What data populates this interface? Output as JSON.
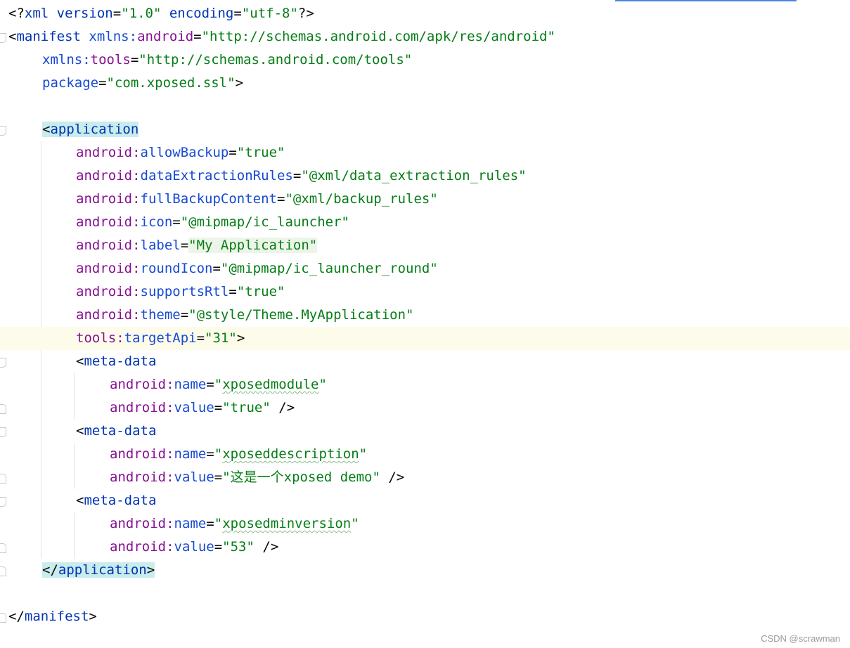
{
  "file": {
    "lines": [
      {
        "tokens": [
          {
            "t": "<?",
            "c": "punc"
          },
          {
            "t": "xml version",
            "c": "tag"
          },
          {
            "t": "=",
            "c": "punc"
          },
          {
            "t": "\"1.0\"",
            "c": "val"
          },
          {
            "t": " ",
            "c": "punc"
          },
          {
            "t": "encoding",
            "c": "tag"
          },
          {
            "t": "=",
            "c": "punc"
          },
          {
            "t": "\"utf-8\"",
            "c": "val"
          },
          {
            "t": "?>",
            "c": "punc"
          }
        ]
      },
      {
        "tokens": [
          {
            "t": "<",
            "c": "punc"
          },
          {
            "t": "manifest",
            "c": "tag"
          },
          {
            "t": " ",
            "c": "punc"
          },
          {
            "t": "xmlns:",
            "c": "attr"
          },
          {
            "t": "android",
            "c": "attr-ns"
          },
          {
            "t": "=",
            "c": "punc"
          },
          {
            "t": "\"http://schemas.android.com/apk/res/android\"",
            "c": "val"
          }
        ]
      },
      {
        "tokens": [
          {
            "t": "xmlns:",
            "c": "attr"
          },
          {
            "t": "tools",
            "c": "attr-ns"
          },
          {
            "t": "=",
            "c": "punc"
          },
          {
            "t": "\"http://schemas.android.com/tools\"",
            "c": "val"
          }
        ]
      },
      {
        "tokens": [
          {
            "t": "package",
            "c": "attr"
          },
          {
            "t": "=",
            "c": "punc"
          },
          {
            "t": "\"com.xposed.ssl\"",
            "c": "val"
          },
          {
            "t": ">",
            "c": "punc"
          }
        ]
      },
      {
        "tokens": []
      },
      {
        "tokens": [
          {
            "t": "<",
            "c": "punc",
            "hl": "tag"
          },
          {
            "t": "application",
            "c": "tag",
            "hl": "tag"
          }
        ]
      },
      {
        "tokens": [
          {
            "t": "android:",
            "c": "attr-ns"
          },
          {
            "t": "allowBackup",
            "c": "attr"
          },
          {
            "t": "=",
            "c": "punc"
          },
          {
            "t": "\"true\"",
            "c": "val"
          }
        ]
      },
      {
        "tokens": [
          {
            "t": "android:",
            "c": "attr-ns"
          },
          {
            "t": "dataExtractionRules",
            "c": "attr"
          },
          {
            "t": "=",
            "c": "punc"
          },
          {
            "t": "\"@xml/data_extraction_rules\"",
            "c": "val"
          }
        ]
      },
      {
        "tokens": [
          {
            "t": "android:",
            "c": "attr-ns"
          },
          {
            "t": "fullBackupContent",
            "c": "attr"
          },
          {
            "t": "=",
            "c": "punc"
          },
          {
            "t": "\"@xml/backup_rules\"",
            "c": "val"
          }
        ]
      },
      {
        "tokens": [
          {
            "t": "android:",
            "c": "attr-ns"
          },
          {
            "t": "icon",
            "c": "attr"
          },
          {
            "t": "=",
            "c": "punc"
          },
          {
            "t": "\"@mipmap/ic_launcher\"",
            "c": "val"
          }
        ]
      },
      {
        "tokens": [
          {
            "t": "android:",
            "c": "attr-ns"
          },
          {
            "t": "label",
            "c": "attr"
          },
          {
            "t": "=",
            "c": "punc"
          },
          {
            "t": "\"My Application\"",
            "c": "val",
            "hl": "val"
          }
        ]
      },
      {
        "tokens": [
          {
            "t": "android:",
            "c": "attr-ns"
          },
          {
            "t": "roundIcon",
            "c": "attr"
          },
          {
            "t": "=",
            "c": "punc"
          },
          {
            "t": "\"@mipmap/ic_launcher_round\"",
            "c": "val"
          }
        ]
      },
      {
        "tokens": [
          {
            "t": "android:",
            "c": "attr-ns"
          },
          {
            "t": "supportsRtl",
            "c": "attr"
          },
          {
            "t": "=",
            "c": "punc"
          },
          {
            "t": "\"true\"",
            "c": "val"
          }
        ]
      },
      {
        "tokens": [
          {
            "t": "android:",
            "c": "attr-ns"
          },
          {
            "t": "theme",
            "c": "attr"
          },
          {
            "t": "=",
            "c": "punc"
          },
          {
            "t": "\"@style/Theme.MyApplication\"",
            "c": "val"
          }
        ]
      },
      {
        "tokens": [
          {
            "t": "tools:",
            "c": "attr-ns"
          },
          {
            "t": "targetApi",
            "c": "attr"
          },
          {
            "t": "=",
            "c": "punc"
          },
          {
            "t": "\"31\"",
            "c": "val"
          },
          {
            "t": ">",
            "c": "punc"
          }
        ],
        "current": true
      },
      {
        "tokens": [
          {
            "t": "<",
            "c": "punc"
          },
          {
            "t": "meta-data",
            "c": "tag"
          }
        ]
      },
      {
        "tokens": [
          {
            "t": "android:",
            "c": "attr-ns"
          },
          {
            "t": "name",
            "c": "attr"
          },
          {
            "t": "=",
            "c": "punc"
          },
          {
            "t": "\"",
            "c": "val"
          },
          {
            "t": "xposedmodule",
            "c": "val",
            "typo": true
          },
          {
            "t": "\"",
            "c": "val"
          }
        ]
      },
      {
        "tokens": [
          {
            "t": "android:",
            "c": "attr-ns"
          },
          {
            "t": "value",
            "c": "attr"
          },
          {
            "t": "=",
            "c": "punc"
          },
          {
            "t": "\"true\"",
            "c": "val"
          },
          {
            "t": " />",
            "c": "punc"
          }
        ]
      },
      {
        "tokens": [
          {
            "t": "<",
            "c": "punc"
          },
          {
            "t": "meta-data",
            "c": "tag"
          }
        ]
      },
      {
        "tokens": [
          {
            "t": "android:",
            "c": "attr-ns"
          },
          {
            "t": "name",
            "c": "attr"
          },
          {
            "t": "=",
            "c": "punc"
          },
          {
            "t": "\"",
            "c": "val"
          },
          {
            "t": "xposeddescription",
            "c": "val",
            "typo": true
          },
          {
            "t": "\"",
            "c": "val"
          }
        ]
      },
      {
        "tokens": [
          {
            "t": "android:",
            "c": "attr-ns"
          },
          {
            "t": "value",
            "c": "attr"
          },
          {
            "t": "=",
            "c": "punc"
          },
          {
            "t": "\"",
            "c": "val"
          },
          {
            "t": "这是一个",
            "c": "val",
            "cjk": true
          },
          {
            "t": "xposed demo\"",
            "c": "val"
          },
          {
            "t": " />",
            "c": "punc"
          }
        ]
      },
      {
        "tokens": [
          {
            "t": "<",
            "c": "punc"
          },
          {
            "t": "meta-data",
            "c": "tag"
          }
        ]
      },
      {
        "tokens": [
          {
            "t": "android:",
            "c": "attr-ns"
          },
          {
            "t": "name",
            "c": "attr"
          },
          {
            "t": "=",
            "c": "punc"
          },
          {
            "t": "\"",
            "c": "val"
          },
          {
            "t": "xposedminversion",
            "c": "val",
            "typo": true
          },
          {
            "t": "\"",
            "c": "val"
          }
        ]
      },
      {
        "tokens": [
          {
            "t": "android:",
            "c": "attr-ns"
          },
          {
            "t": "value",
            "c": "attr"
          },
          {
            "t": "=",
            "c": "punc"
          },
          {
            "t": "\"53\"",
            "c": "val"
          },
          {
            "t": " />",
            "c": "punc"
          }
        ]
      },
      {
        "tokens": [
          {
            "t": "</",
            "c": "punc",
            "hl": "tag"
          },
          {
            "t": "application",
            "c": "tag",
            "hl": "tag"
          },
          {
            "t": ">",
            "c": "punc",
            "hl": "tag"
          }
        ]
      },
      {
        "tokens": []
      },
      {
        "tokens": [
          {
            "t": "</",
            "c": "punc"
          },
          {
            "t": "manifest",
            "c": "tag"
          },
          {
            "t": ">",
            "c": "punc"
          }
        ]
      }
    ]
  },
  "watermark": "CSDN @scrawman",
  "colors": {
    "tag": "#0033b3",
    "attr": "#174ad4",
    "attr_ns": "#871094",
    "value": "#067d17",
    "current_line": "#fdfbea",
    "tag_highlight": "#c9ecec"
  }
}
